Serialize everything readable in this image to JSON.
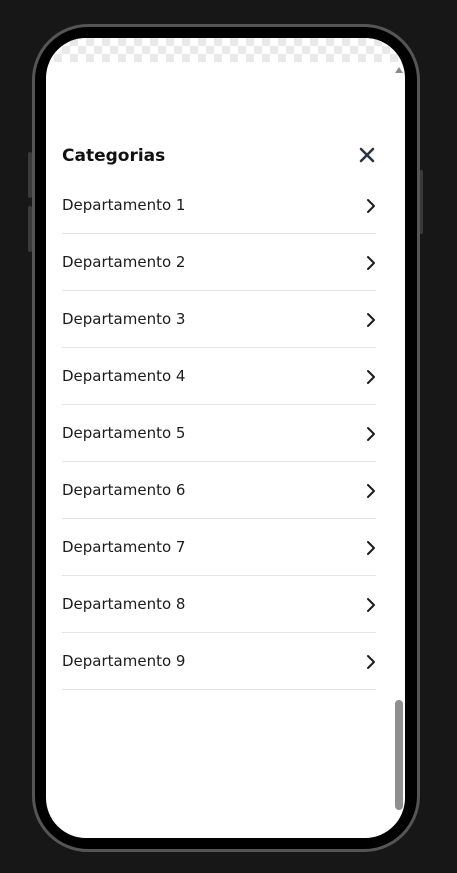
{
  "modal": {
    "title": "Categorias",
    "close_icon": "close-icon"
  },
  "departments": [
    {
      "label": "Departamento 1",
      "icon": "chevron-right-icon"
    },
    {
      "label": "Departamento 2",
      "icon": "chevron-right-icon"
    },
    {
      "label": "Departamento 3",
      "icon": "chevron-right-icon"
    },
    {
      "label": "Departamento 4",
      "icon": "chevron-right-icon"
    },
    {
      "label": "Departamento 5",
      "icon": "chevron-right-icon"
    },
    {
      "label": "Departamento 6",
      "icon": "chevron-right-icon"
    },
    {
      "label": "Departamento 7",
      "icon": "chevron-right-icon"
    },
    {
      "label": "Departamento 8",
      "icon": "chevron-right-icon"
    },
    {
      "label": "Departamento 9",
      "icon": "chevron-right-icon"
    }
  ],
  "colors": {
    "page_background": "#171717",
    "screen_background": "#ffffff",
    "text": "#1c1c1c",
    "divider": "#e4e4e4",
    "icon": "#1c1c1c"
  }
}
